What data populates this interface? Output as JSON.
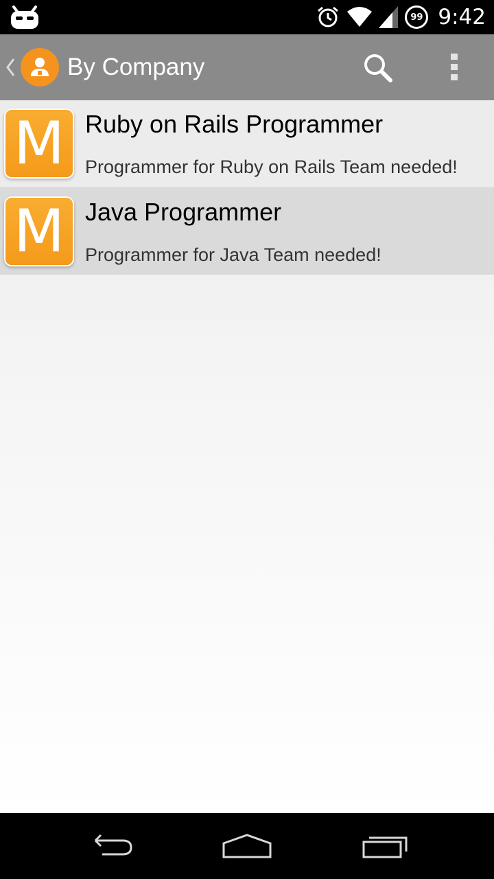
{
  "status_bar": {
    "left_icon": "cyanogenmod-bugdroid-icon",
    "alarm_icon": "alarm-clock-icon",
    "wifi_icon": "wifi-icon",
    "signal_icon": "cell-signal-icon",
    "battery_level": "99",
    "time": "9:42"
  },
  "action_bar": {
    "title": "By Company",
    "background_color": "#8a8a8a",
    "logo_color": "#f5931f",
    "search_icon": "search-icon",
    "overflow_icon": "overflow-menu-icon"
  },
  "list": {
    "items": [
      {
        "icon_letter": "M",
        "title": "Ruby on Rails Programmer",
        "subtitle": "Programmer for Ruby on Rails Team needed!"
      },
      {
        "icon_letter": "M",
        "title": "Java Programmer",
        "subtitle": "Programmer for Java Team needed!"
      }
    ],
    "icon_color": "#f7a327"
  },
  "nav_bar": {
    "back_icon": "back-icon",
    "home_icon": "home-icon",
    "recents_icon": "recents-icon"
  }
}
